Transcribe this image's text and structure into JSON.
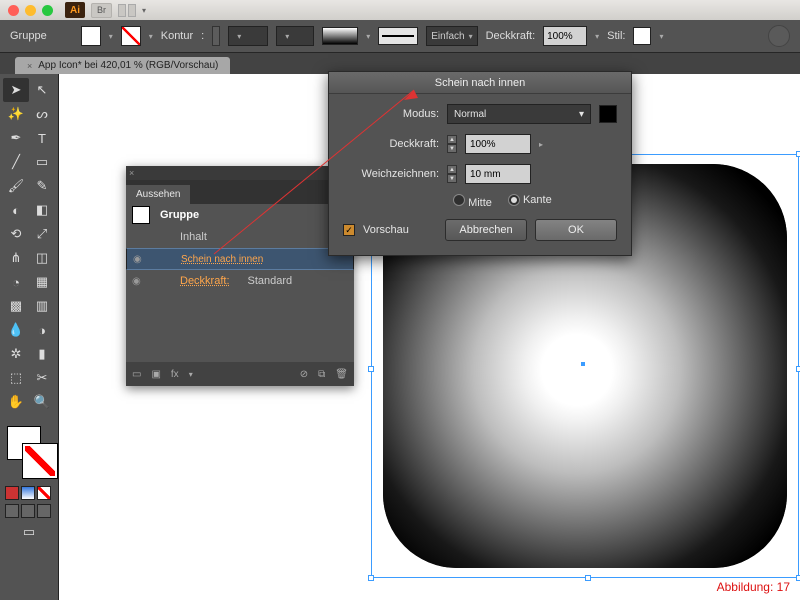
{
  "window": {
    "app_badge": "Ai",
    "bridge_badge": "Br"
  },
  "controlbar": {
    "selection_label": "Gruppe",
    "stroke_label": "Kontur",
    "stroke_width": "",
    "stroke_style_label": "Einfach",
    "opacity_label": "Deckkraft:",
    "opacity_value": "100%",
    "style_label": "Stil:"
  },
  "document": {
    "tab_title": "App Icon* bei 420,01 % (RGB/Vorschau)"
  },
  "appearance": {
    "panel_title": "Aussehen",
    "group_label": "Gruppe",
    "contents_label": "Inhalt",
    "effect_label": "Schein nach innen",
    "opacity_label": "Deckkraft:",
    "opacity_value": "Standard",
    "fx_label": "fx"
  },
  "dialog": {
    "title": "Schein nach innen",
    "mode_label": "Modus:",
    "mode_value": "Normal",
    "opacity_label": "Deckkraft:",
    "opacity_value": "100%",
    "blur_label": "Weichzeichnen:",
    "blur_value": "10 mm",
    "radio_center": "Mitte",
    "radio_edge": "Kante",
    "preview_label": "Vorschau",
    "cancel": "Abbrechen",
    "ok": "OK"
  },
  "caption": "Abbildung: 17",
  "icons": {
    "chev": "▾",
    "chev_r": "▸",
    "up": "▲",
    "down": "▼",
    "eye": "◉",
    "checkmark": "✓",
    "close": "×",
    "menu": "≡"
  }
}
